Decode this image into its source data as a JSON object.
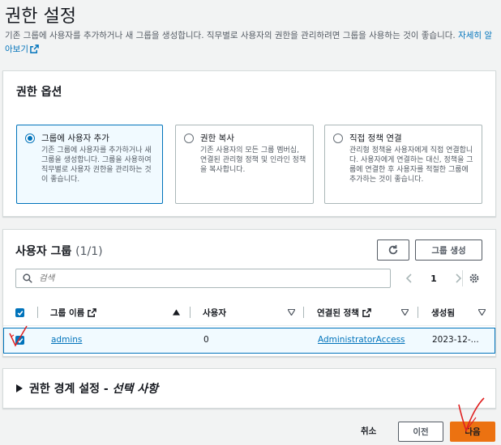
{
  "header": {
    "title": "권한 설정",
    "description": "기존 그룹에 사용자를 추가하거나 새 그룹을 생성합니다. 직무별로 사용자의 권한을 관리하려면 그룹을 사용하는 것이 좋습니다.",
    "learn_more": "자세히 알아보기"
  },
  "permission_options": {
    "title": "권한 옵션",
    "options": [
      {
        "title": "그룹에 사용자 추가",
        "description": "기존 그룹에 사용자를 추가하거나 새 그룹을 생성합니다. 그룹을 사용하여 직무별로 사용자 권한을 관리하는 것이 좋습니다.",
        "selected": true
      },
      {
        "title": "권한 복사",
        "description": "기존 사용자의 모든 그룹 멤버십, 연결된 관리형 정책 및 인라인 정책을 복사합니다.",
        "selected": false
      },
      {
        "title": "직접 정책 연결",
        "description": "관리형 정책을 사용자에게 직접 연결합니다. 사용자에게 연결하는 대신, 정책을 그룹에 연결한 후 사용자를 적절한 그룹에 추가하는 것이 좋습니다.",
        "selected": false
      }
    ]
  },
  "user_groups": {
    "title": "사용자 그룹",
    "count": "(1/1)",
    "create_group_label": "그룹 생성",
    "search_placeholder": "검색",
    "page": "1",
    "columns": {
      "group_name": "그룹 이름",
      "users": "사용자",
      "attached_policies": "연결된 정책",
      "created": "생성됨"
    },
    "rows": [
      {
        "group_name": "admins",
        "users": "0",
        "attached_policies": "AdministratorAccess",
        "created": "2023-12-...",
        "checked": true
      }
    ]
  },
  "boundary": {
    "title": "권한 경계 설정 - ",
    "title_italic": "선택 사항"
  },
  "footer": {
    "cancel": "취소",
    "previous": "이전",
    "next": "다음"
  },
  "colors": {
    "accent": "#0073bb",
    "primary_button": "#ec7211",
    "annotation": "#e02020"
  },
  "icons": [
    "external-link-icon",
    "refresh-icon",
    "search-icon",
    "settings-gear-icon",
    "caret-right-icon",
    "sort-asc-icon",
    "sort-desc-icon"
  ]
}
